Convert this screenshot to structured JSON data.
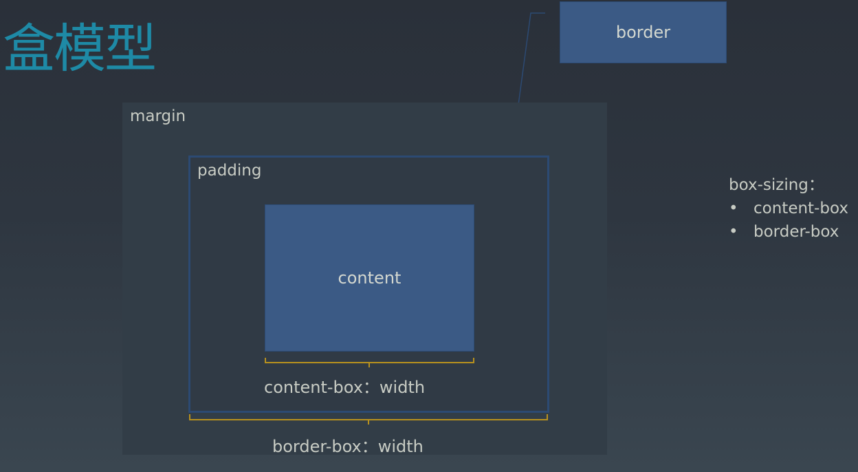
{
  "title": "盒模型",
  "diagram": {
    "border_label": "border",
    "margin_label": "margin",
    "padding_label": "padding",
    "content_label": "content",
    "content_box_width_label": "content-box：width",
    "border_box_width_label": "border-box：width"
  },
  "box_sizing": {
    "heading": "box-sizing：",
    "items": [
      "content-box",
      "border-box"
    ]
  },
  "colors": {
    "title": "#1e8aa6",
    "box_fill": "#3b5a85",
    "bracket": "#b8911e",
    "border_line": "#2c4a73"
  }
}
